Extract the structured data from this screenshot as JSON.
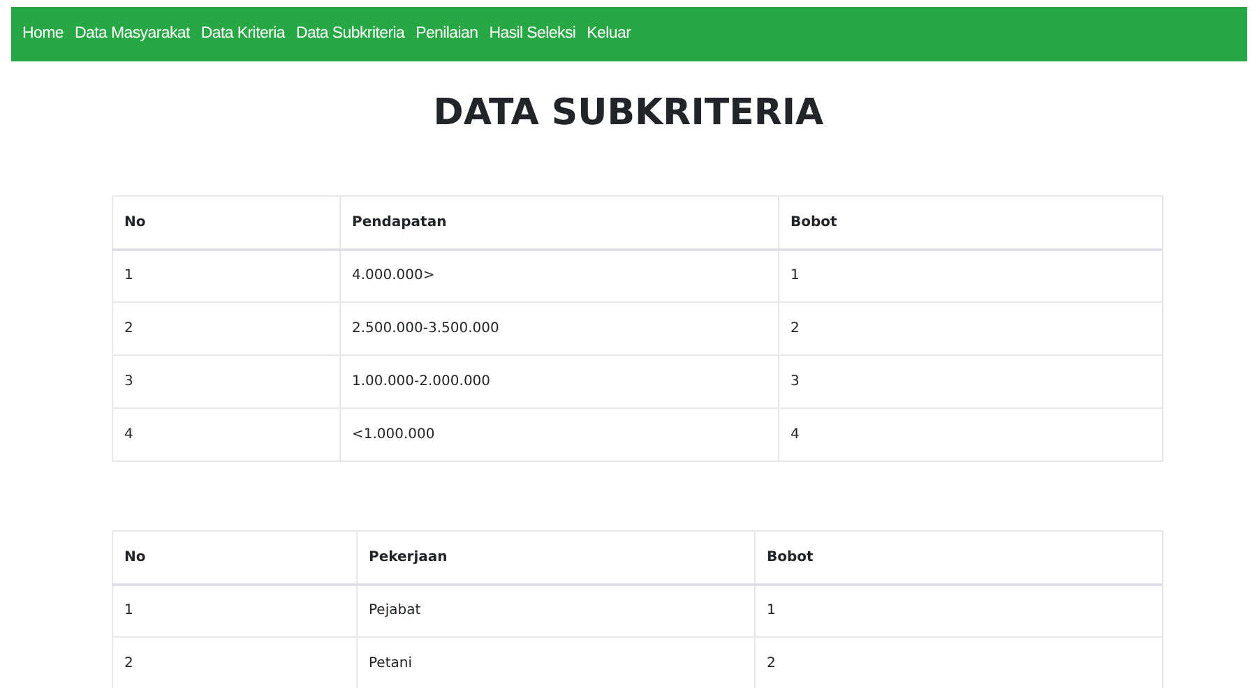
{
  "navbar": {
    "items": [
      "Home",
      "Data Masyarakat",
      "Data Kriteria",
      "Data Subkriteria",
      "Penilaian",
      "Hasil Seleksi",
      "Keluar"
    ]
  },
  "title": "DATA SUBKRITERIA",
  "tables": [
    {
      "columns": [
        "No",
        "Pendapatan",
        "Bobot"
      ],
      "rows": [
        [
          "1",
          "4.000.000>",
          "1"
        ],
        [
          "2",
          "2.500.000-3.500.000",
          "2"
        ],
        [
          "3",
          "1.00.000-2.000.000",
          "3"
        ],
        [
          "4",
          "<1.000.000",
          "4"
        ]
      ]
    },
    {
      "columns": [
        "No",
        "Pekerjaan",
        "Bobot"
      ],
      "rows": [
        [
          "1",
          "Pejabat",
          "1"
        ],
        [
          "2",
          "Petani",
          "2"
        ]
      ]
    }
  ]
}
